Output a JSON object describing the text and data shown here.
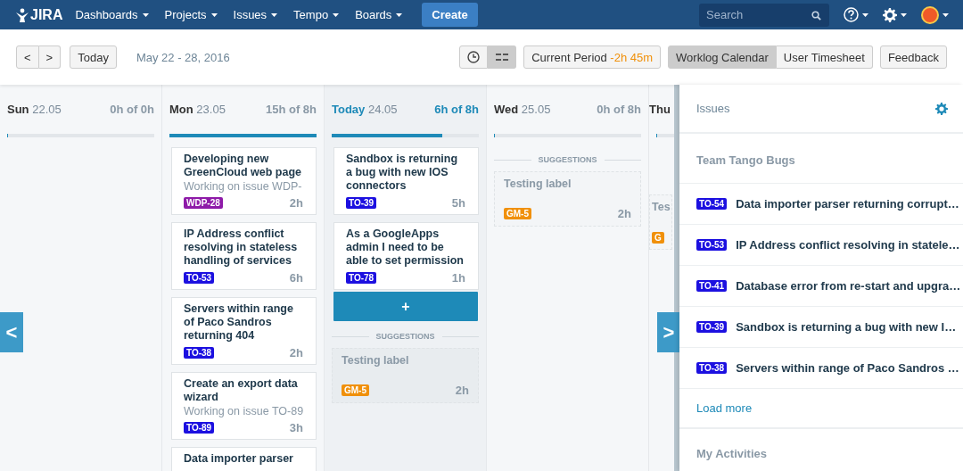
{
  "nav": {
    "logo": "JIRA",
    "menus": [
      "Dashboards",
      "Projects",
      "Issues",
      "Tempo",
      "Boards"
    ],
    "create": "Create",
    "search": {
      "placeholder": "Search"
    }
  },
  "toolbar": {
    "prev": "<",
    "next": ">",
    "today": "Today",
    "range": "May 22 - 28, 2016",
    "views": [
      {
        "kind": "clock",
        "selected": false
      },
      {
        "kind": "list",
        "selected": true
      }
    ],
    "period": {
      "label": "Current Period",
      "value": "-2h 45m"
    },
    "modes": [
      {
        "label": "Worklog Calendar",
        "selected": true
      },
      {
        "label": "User Timesheet",
        "selected": false
      }
    ],
    "feedback": "Feedback"
  },
  "days": [
    {
      "name": "Sun",
      "date": "22.05",
      "hours": "0h of 0h",
      "today": false,
      "level": 0
    },
    {
      "name": "Mon",
      "date": "23.05",
      "hours": "15h of 8h",
      "today": false,
      "level": 1,
      "cards": [
        {
          "title": "Developing new GreenCloud web page",
          "description": "Working on issue WDP-",
          "tag": "WDP-28",
          "color": "#8e1aa8",
          "hours": "2h"
        },
        {
          "title": "IP Address conflict resolving in stateless handling of services",
          "tag": "TO-53",
          "color": "#1c10e0",
          "hours": "6h"
        },
        {
          "title": "Servers within range of Paco Sandros returning 404",
          "tag": "TO-38",
          "color": "#1c10e0",
          "hours": "2h"
        },
        {
          "title": "Create an export data wizard",
          "description": "Working on issue TO-89",
          "tag": "TO-89",
          "color": "#1c10e0",
          "hours": "3h"
        },
        {
          "title": "Data importer parser"
        }
      ]
    },
    {
      "name": "Today",
      "date": "24.05",
      "hours": "6h of 8h",
      "today": true,
      "level": 0.75,
      "cards": [
        {
          "title": "Sandbox is returning a bug with new IOS connectors",
          "tag": "TO-39",
          "color": "#1c10e0",
          "hours": "5h"
        },
        {
          "title": "As a GoogleApps admin I need to be able to set permission",
          "tag": "TO-78",
          "color": "#1c10e0",
          "hours": "1h"
        }
      ],
      "add": "+",
      "suggestions_label": "SUGGESTIONS",
      "suggestions": [
        {
          "title": "Testing label",
          "tag": "GM-5",
          "color": "#f0900a",
          "hours": "2h"
        }
      ]
    },
    {
      "name": "Wed",
      "date": "25.05",
      "hours": "0h of 8h",
      "today": false,
      "level": 0,
      "suggestions_label": "SUGGESTIONS",
      "suggestions": [
        {
          "title": "Testing label",
          "tag": "GM-5",
          "color": "#f0900a",
          "hours": "2h"
        }
      ]
    },
    {
      "name": "Thu",
      "today": false,
      "level": 0,
      "suggestions": [
        {
          "title": "Tes",
          "tag": "G",
          "color": "#f0900a"
        }
      ]
    }
  ],
  "pager": {
    "prev": "<",
    "next": ">"
  },
  "sidebar": {
    "title": "Issues",
    "section": "Team Tango Bugs",
    "issues": [
      {
        "tag": "TO-54",
        "title": "Data importer parser returning corrupt…"
      },
      {
        "tag": "TO-53",
        "title": "IP Address conflict resolving in statele…"
      },
      {
        "tag": "TO-41",
        "title": "Database error from re-start and upgra…"
      },
      {
        "tag": "TO-39",
        "title": "Sandbox is returning a bug with new I…"
      },
      {
        "tag": "TO-38",
        "title": "Servers within range of Paco Sandros …"
      }
    ],
    "load_more": "Load more",
    "activities": "My Activities"
  }
}
